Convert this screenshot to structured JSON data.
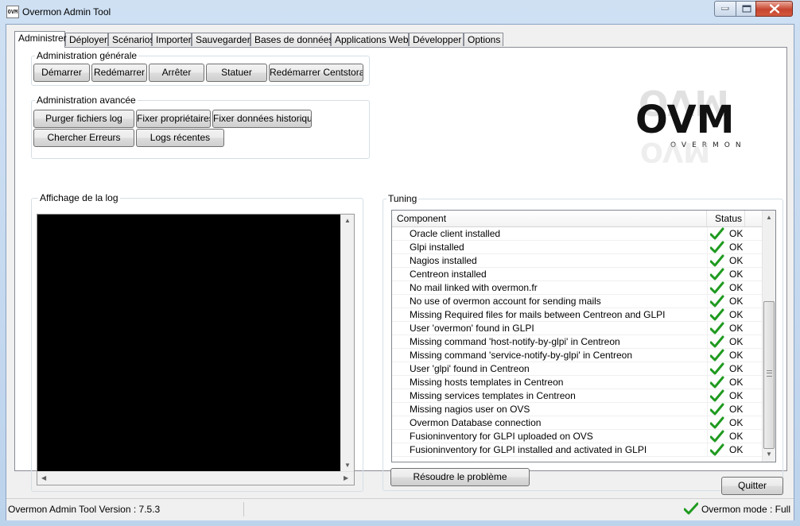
{
  "window": {
    "title": "Overmon Admin Tool",
    "app_icon_text": "OVM"
  },
  "tabs": [
    {
      "label": "Administrer",
      "active": true
    },
    {
      "label": "Déployer"
    },
    {
      "label": "Scénarios"
    },
    {
      "label": "Importer"
    },
    {
      "label": "Sauvegarder"
    },
    {
      "label": "Bases de données"
    },
    {
      "label": "Applications Web"
    },
    {
      "label": "Développer"
    },
    {
      "label": "Options"
    }
  ],
  "admin_general": {
    "legend": "Administration générale",
    "buttons": [
      "Démarrer",
      "Redémarrer",
      "Arrêter",
      "Statuer",
      "Redémarrer Centstorage"
    ]
  },
  "admin_advanced": {
    "legend": "Administration avancée",
    "buttons": [
      "Purger fichiers log",
      "Fixer propriétaires",
      "Fixer données historiques",
      "Chercher Erreurs",
      "Logs récentes"
    ]
  },
  "logo": {
    "text": "OVM",
    "subtitle": "OVERMON"
  },
  "log_panel": {
    "legend": "Affichage de la log"
  },
  "tuning": {
    "legend": "Tuning",
    "columns": {
      "component": "Component",
      "status": "Status"
    },
    "rows": [
      {
        "component": "Oracle client installed",
        "status": "OK"
      },
      {
        "component": "Glpi installed",
        "status": "OK"
      },
      {
        "component": "Nagios installed",
        "status": "OK"
      },
      {
        "component": "Centreon installed",
        "status": "OK"
      },
      {
        "component": "No mail linked with overmon.fr",
        "status": "OK"
      },
      {
        "component": "No use of overmon account for sending mails",
        "status": "OK"
      },
      {
        "component": "Missing Required files for mails between Centreon and GLPI",
        "status": "OK"
      },
      {
        "component": "User 'overmon' found in GLPI",
        "status": "OK"
      },
      {
        "component": "Missing command 'host-notify-by-glpi' in Centreon",
        "status": "OK"
      },
      {
        "component": "Missing command 'service-notify-by-glpi' in Centreon",
        "status": "OK"
      },
      {
        "component": "User 'glpi' found in Centreon",
        "status": "OK"
      },
      {
        "component": "Missing hosts templates in Centreon",
        "status": "OK"
      },
      {
        "component": "Missing services templates in Centreon",
        "status": "OK"
      },
      {
        "component": "Missing nagios user on OVS",
        "status": "OK"
      },
      {
        "component": "Overmon Database connection",
        "status": "OK"
      },
      {
        "component": "Fusioninventory for GLPI uploaded on OVS",
        "status": "OK"
      },
      {
        "component": "Fusioninventory for GLPI installed and activated in GLPI",
        "status": "OK"
      }
    ],
    "resolve_button": "Résoudre le problème"
  },
  "quit_button": "Quitter",
  "statusbar": {
    "version": "Overmon Admin Tool Version : 7.5.3",
    "mode": "Overmon mode : Full"
  },
  "colors": {
    "ok_check": "#1f9a1f",
    "close_button": "#c7452f",
    "log_background": "#000000"
  },
  "icons": [
    "app-icon",
    "minimize-icon",
    "maximize-icon",
    "close-icon",
    "check-icon"
  ]
}
